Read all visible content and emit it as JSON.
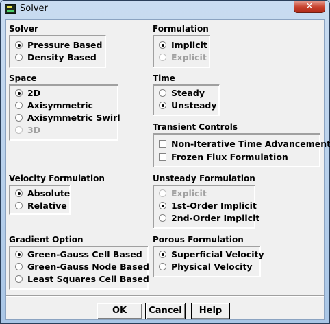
{
  "window": {
    "title": "Solver",
    "close_glyph": "✕"
  },
  "solver": {
    "label": "Solver",
    "options": [
      {
        "label": "Pressure Based",
        "selected": true,
        "enabled": true
      },
      {
        "label": "Density Based",
        "selected": false,
        "enabled": true
      }
    ]
  },
  "formulation": {
    "label": "Formulation",
    "options": [
      {
        "label": "Implicit",
        "selected": true,
        "enabled": true
      },
      {
        "label": "Explicit",
        "selected": false,
        "enabled": false
      }
    ]
  },
  "space": {
    "label": "Space",
    "options": [
      {
        "label": "2D",
        "selected": true,
        "enabled": true
      },
      {
        "label": "Axisymmetric",
        "selected": false,
        "enabled": true
      },
      {
        "label": "Axisymmetric Swirl",
        "selected": false,
        "enabled": true
      },
      {
        "label": "3D",
        "selected": false,
        "enabled": false
      }
    ]
  },
  "time": {
    "label": "Time",
    "options": [
      {
        "label": "Steady",
        "selected": false,
        "enabled": true
      },
      {
        "label": "Unsteady",
        "selected": true,
        "enabled": true
      }
    ]
  },
  "transient_controls": {
    "label": "Transient Controls",
    "options": [
      {
        "label": "Non-Iterative Time Advancement",
        "checked": false
      },
      {
        "label": "Frozen Flux Formulation",
        "checked": false
      }
    ]
  },
  "velocity_formulation": {
    "label": "Velocity Formulation",
    "options": [
      {
        "label": "Absolute",
        "selected": true,
        "enabled": true
      },
      {
        "label": "Relative",
        "selected": false,
        "enabled": true
      }
    ]
  },
  "unsteady_formulation": {
    "label": "Unsteady Formulation",
    "options": [
      {
        "label": "Explicit",
        "selected": false,
        "enabled": false
      },
      {
        "label": "1st-Order Implicit",
        "selected": true,
        "enabled": true
      },
      {
        "label": "2nd-Order Implicit",
        "selected": false,
        "enabled": true
      }
    ]
  },
  "gradient_option": {
    "label": "Gradient Option",
    "options": [
      {
        "label": "Green-Gauss Cell Based",
        "selected": true,
        "enabled": true
      },
      {
        "label": "Green-Gauss Node Based",
        "selected": false,
        "enabled": true
      },
      {
        "label": "Least Squares Cell Based",
        "selected": false,
        "enabled": true
      }
    ]
  },
  "porous_formulation": {
    "label": "Porous Formulation",
    "options": [
      {
        "label": "Superficial Velocity",
        "selected": true,
        "enabled": true
      },
      {
        "label": "Physical Velocity",
        "selected": false,
        "enabled": true
      }
    ]
  },
  "buttons": {
    "ok": "OK",
    "cancel": "Cancel",
    "help": "Help"
  }
}
